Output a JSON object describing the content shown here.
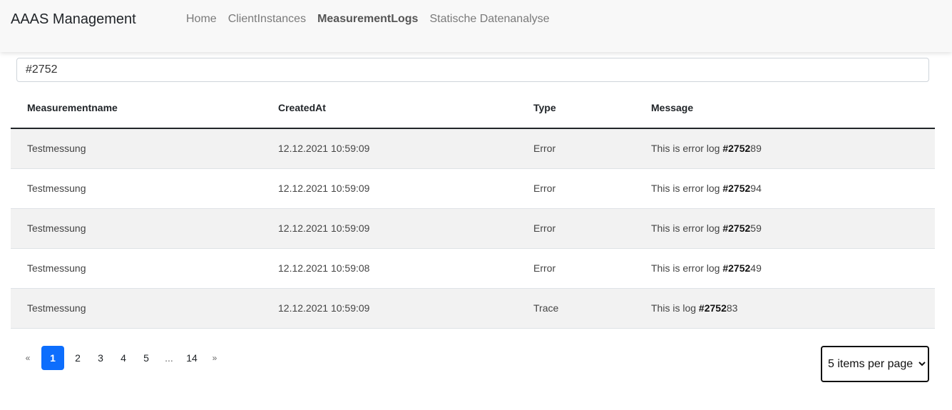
{
  "navbar": {
    "brand": "AAAS Management",
    "links": [
      {
        "label": "Home"
      },
      {
        "label": "ClientInstances"
      },
      {
        "label": "MeasurementLogs",
        "active": true
      },
      {
        "label": "Statische Datenanalyse"
      }
    ]
  },
  "search": {
    "value": "#2752"
  },
  "table": {
    "headers": [
      "Measurementname",
      "CreatedAt",
      "Type",
      "Message"
    ],
    "rows": [
      {
        "name": "Testmessung",
        "created": "12.12.2021 10:59:09",
        "type": "Error",
        "msg_prefix": "This is error log ",
        "msg_match": "#2752",
        "msg_suffix": "89"
      },
      {
        "name": "Testmessung",
        "created": "12.12.2021 10:59:09",
        "type": "Error",
        "msg_prefix": "This is error log ",
        "msg_match": "#2752",
        "msg_suffix": "94"
      },
      {
        "name": "Testmessung",
        "created": "12.12.2021 10:59:09",
        "type": "Error",
        "msg_prefix": "This is error log ",
        "msg_match": "#2752",
        "msg_suffix": "59"
      },
      {
        "name": "Testmessung",
        "created": "12.12.2021 10:59:08",
        "type": "Error",
        "msg_prefix": "This is error log ",
        "msg_match": "#2752",
        "msg_suffix": "49"
      },
      {
        "name": "Testmessung",
        "created": "12.12.2021 10:59:09",
        "type": "Trace",
        "msg_prefix": "This is log ",
        "msg_match": "#2752",
        "msg_suffix": "83"
      }
    ]
  },
  "pagination": {
    "prev": "«",
    "pages": [
      "1",
      "2",
      "3",
      "4",
      "5"
    ],
    "ellipsis": "...",
    "last": "14",
    "next": "»",
    "current": "1"
  },
  "per_page": {
    "selected": "5 items per page"
  }
}
